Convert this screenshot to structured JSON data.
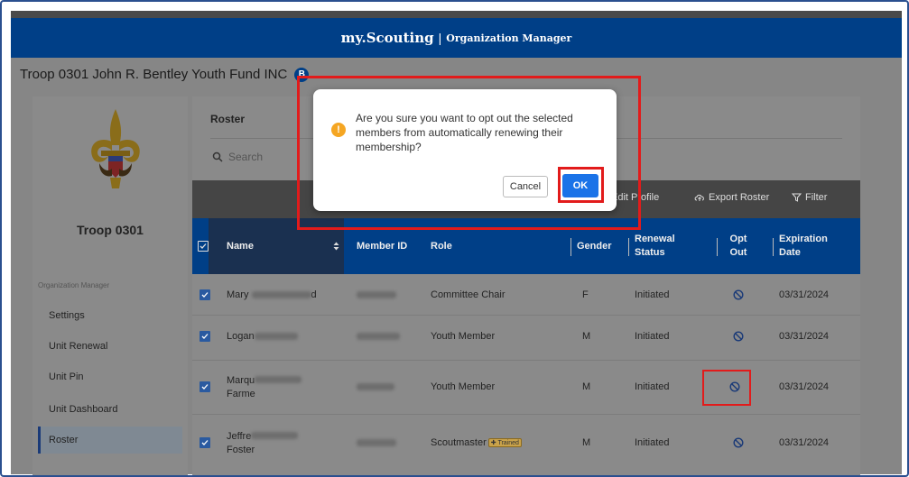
{
  "header": {
    "brand": "my.Scouting",
    "separator": "|",
    "subtitle": "Organization Manager"
  },
  "org": {
    "title": "Troop 0301 John R. Bentley Youth Fund INC",
    "badge": "B"
  },
  "sidebar": {
    "troop_name": "Troop 0301",
    "section_label": "Organization Manager",
    "items": [
      {
        "label": "Settings"
      },
      {
        "label": "Unit Renewal"
      },
      {
        "label": "Unit Pin"
      },
      {
        "label": "Unit Dashboard"
      },
      {
        "label": "Roster"
      }
    ],
    "active_item": "Roster"
  },
  "roster": {
    "title": "Roster",
    "search_placeholder": "Search",
    "toolbar": {
      "edit_profile": "Edit Profile",
      "export_roster": "Export Roster",
      "filter": "Filter"
    },
    "columns": {
      "name": "Name",
      "member_id": "Member ID",
      "role": "Role",
      "gender": "Gender",
      "renewal_status": "Renewal Status",
      "opt_out": "Opt Out",
      "expiration_date": "Expiration Date"
    },
    "rows": [
      {
        "name": "Mary",
        "name_tail": "d",
        "role": "Committee Chair",
        "gender": "F",
        "status": "Initiated",
        "expiration": "03/31/2024"
      },
      {
        "name": "Logan",
        "name_tail": "",
        "role": "Youth Member",
        "gender": "M",
        "status": "Initiated",
        "expiration": "03/31/2024"
      },
      {
        "name": "Marqu",
        "name2": "Farme",
        "role": "Youth Member",
        "gender": "M",
        "status": "Initiated",
        "expiration": "03/31/2024"
      },
      {
        "name": "Jeffre",
        "name2": "Foster",
        "role": "Scoutmaster",
        "trained": "Trained",
        "gender": "M",
        "status": "Initiated",
        "expiration": "03/31/2024"
      }
    ]
  },
  "modal": {
    "message": "Are you sure you want to opt out the selected members from automatically renewing their membership?",
    "cancel": "Cancel",
    "ok": "OK",
    "icon": "!"
  },
  "colors": {
    "header": "#003f87",
    "ok_button": "#1a73e8",
    "highlight": "#e21b1b",
    "warning": "#f5a623"
  }
}
